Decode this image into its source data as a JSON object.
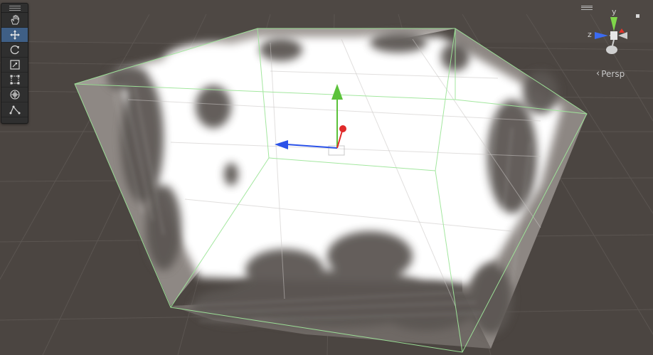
{
  "toolbar": {
    "tools": [
      {
        "name": "view-tool",
        "icon": "hand-icon",
        "active": false
      },
      {
        "name": "move-tool",
        "icon": "move-icon",
        "active": true
      },
      {
        "name": "rotate-tool",
        "icon": "rotate-icon",
        "active": false
      },
      {
        "name": "scale-tool",
        "icon": "scale-icon",
        "active": false
      },
      {
        "name": "rect-tool",
        "icon": "rect-icon",
        "active": false
      },
      {
        "name": "transform-tool",
        "icon": "transform-icon",
        "active": false
      },
      {
        "name": "custom-tool",
        "icon": "custom-tool-icon",
        "active": false
      }
    ]
  },
  "gizmo": {
    "y_label": "y",
    "z_label": "z",
    "projection_label": "Persp",
    "colors": {
      "x": "#e0352b",
      "y": "#7fd64a",
      "z": "#3b6bf2"
    }
  },
  "scene": {
    "background": "#4a4440",
    "volume_outline_color": "#9fe69a",
    "handle_colors": {
      "y": "#66cc33",
      "x": "#e02a2a",
      "z": "#2b52e8"
    }
  }
}
